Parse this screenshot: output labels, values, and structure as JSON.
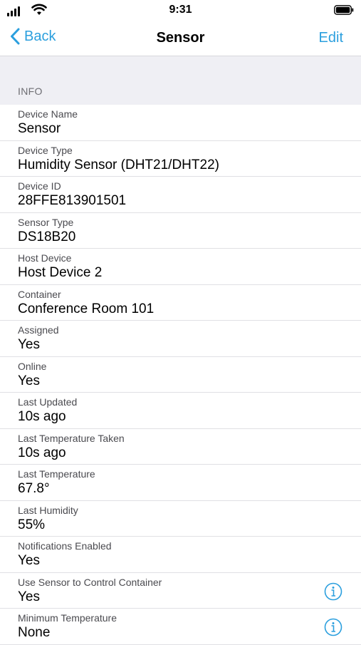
{
  "status_bar": {
    "time": "9:31"
  },
  "nav": {
    "back_label": "Back",
    "title": "Sensor",
    "edit_label": "Edit"
  },
  "section": {
    "title": "INFO"
  },
  "rows": [
    {
      "label": "Device Name",
      "value": "Sensor"
    },
    {
      "label": "Device Type",
      "value": "Humidity Sensor (DHT21/DHT22)"
    },
    {
      "label": "Device ID",
      "value": "28FFE813901501"
    },
    {
      "label": "Sensor Type",
      "value": "DS18B20"
    },
    {
      "label": "Host Device",
      "value": "Host Device 2"
    },
    {
      "label": "Container",
      "value": "Conference Room 101"
    },
    {
      "label": "Assigned",
      "value": "Yes"
    },
    {
      "label": "Online",
      "value": "Yes"
    },
    {
      "label": "Last Updated",
      "value": "10s ago"
    },
    {
      "label": "Last Temperature Taken",
      "value": "10s ago"
    },
    {
      "label": "Last Temperature",
      "value": "67.8°"
    },
    {
      "label": "Last Humidity",
      "value": "55%"
    },
    {
      "label": "Notifications Enabled",
      "value": "Yes"
    },
    {
      "label": "Use Sensor to Control Container",
      "value": "Yes",
      "icon": "info-icon"
    },
    {
      "label": "Minimum Temperature",
      "value": "None",
      "icon": "info-icon"
    }
  ],
  "colors": {
    "accent": "#2b9fde",
    "section_background": "#efeff4",
    "separator": "#e0e0e4"
  }
}
